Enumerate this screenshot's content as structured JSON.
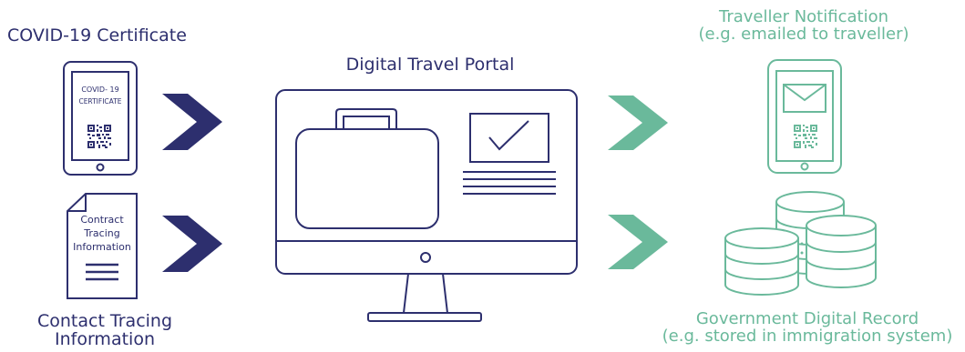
{
  "labels": {
    "covid_certificate": "COVID-19 Certificate",
    "digital_travel_portal": "Digital Travel Portal",
    "traveller_notification_line1": "Traveller Notification",
    "traveller_notification_line2": "(e.g. emailed to traveller)",
    "contact_tracing_line1": "Contact Tracing",
    "contact_tracing_line2": "Information",
    "government_record_line1": "Government Digital Record",
    "government_record_line2": "(e.g. stored in immigration system)"
  },
  "icon_text": {
    "certificate_line1": "COVID- 19",
    "certificate_line2": "CERTIFICATE",
    "contract_line1": "Contract",
    "contract_line2": "Tracing",
    "contract_line3": "Information"
  },
  "icons": [
    "tablet-certificate-icon",
    "document-icon",
    "monitor-icon",
    "briefcase-icon",
    "checked-form-icon",
    "phone-mail-icon",
    "database-coins-icon",
    "chevron-arrow-icon"
  ],
  "colors": {
    "navy": "#2d2f6e",
    "green": "#6ab99b"
  }
}
